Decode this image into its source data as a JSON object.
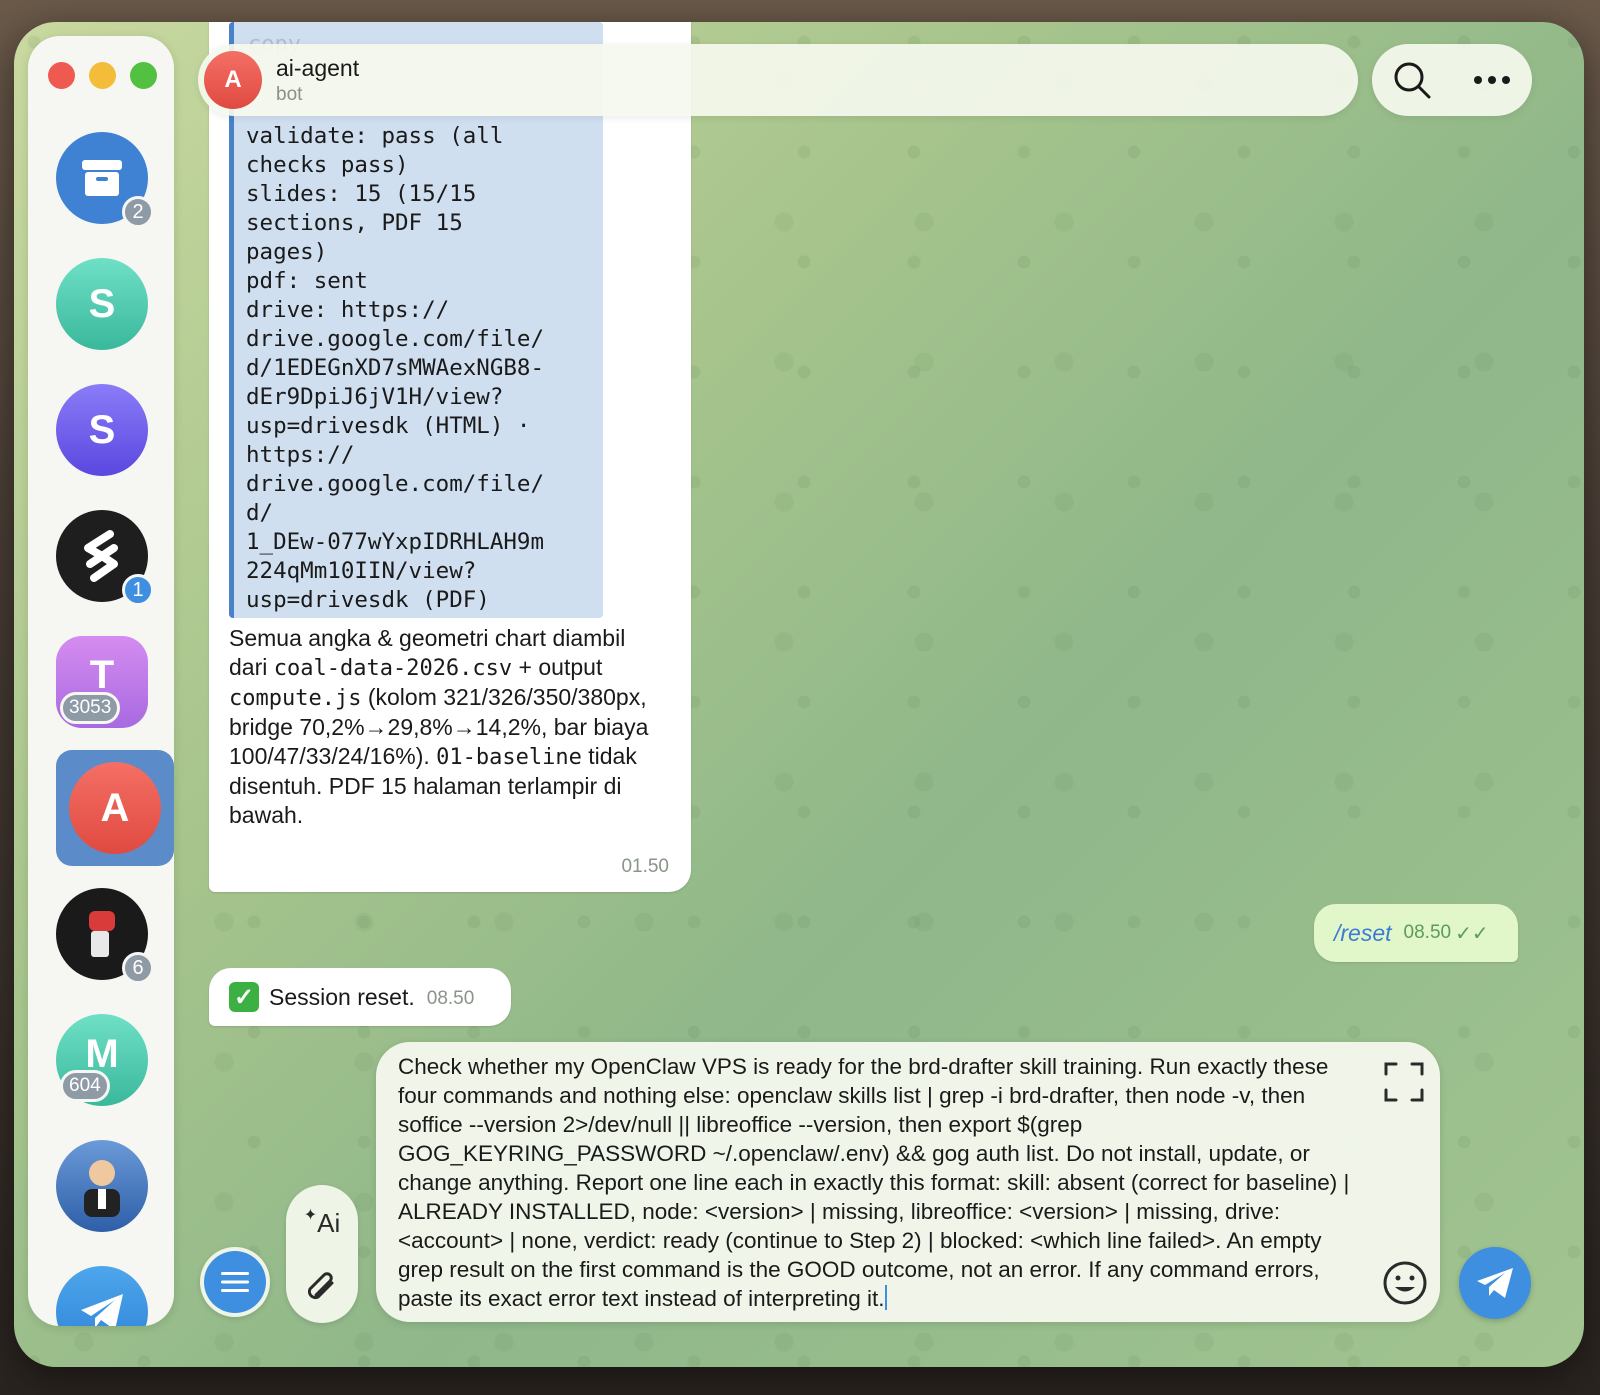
{
  "header": {
    "avatar_letter": "A",
    "title": "ai-agent",
    "subtitle": "bot"
  },
  "sidebar": {
    "items": [
      {
        "letter": "",
        "badge": "2",
        "color": "#3f82d4"
      },
      {
        "letter": "S",
        "badge": "",
        "color": "#4cc9b0"
      },
      {
        "letter": "S",
        "badge": "",
        "color": "#6a5cf0"
      },
      {
        "letter": "",
        "badge": "1",
        "color": "#1e1e1e"
      },
      {
        "letter": "T",
        "badge": "3053",
        "color": "#c27ae8"
      },
      {
        "letter": "A",
        "badge": "",
        "color": "#ee5a50",
        "active": true
      },
      {
        "letter": "",
        "badge": "6",
        "color": "#222222"
      },
      {
        "letter": "M",
        "badge": "604",
        "color": "#54c8a8"
      },
      {
        "letter": "",
        "badge": "",
        "color": "#3c6fb0"
      },
      {
        "letter": "",
        "badge": "",
        "color": "#3f8fe0"
      }
    ]
  },
  "messages": {
    "bot_report": {
      "code_faded": "copy",
      "code_lines": "validate: pass (all\nchecks pass)\nslides: 15 (15/15\nsections, PDF 15\npages)\npdf: sent\ndrive: https://\ndrive.google.com/file/\nd/1EDEGnXD7sMWAexNGB8-\ndEr9DpiJ6jV1H/view?\nusp=drivesdk (HTML) ·\nhttps://\ndrive.google.com/file/\nd/\n1_DEw-077wYxpIDRHLAH9m\n224qMm10IIN/view?\nusp=drivesdk (PDF)",
      "text_a": "Semua angka & geometri chart diambil dari ",
      "mono_a": "coal-data-2026.csv",
      "text_b": " + output ",
      "mono_b": "compute.js",
      "text_c": " (kolom 321/326/350/380px, bridge 70,2%→29,8%→14,2%, bar biaya 100/47/33/24/16%). ",
      "mono_c": "01-baseline",
      "text_d": " tidak disentuh. PDF 15 halaman terlampir di bawah.",
      "time": "01.50"
    },
    "user_reset": {
      "command": "/reset",
      "time": "08.50",
      "ticks": "✓✓"
    },
    "bot_reset": {
      "check": "✓",
      "label": "Session reset.",
      "time": "08.50"
    }
  },
  "composer": {
    "text": "Check whether my OpenClaw VPS is ready for the brd-drafter skill training. Run exactly these four commands and nothing else: openclaw skills list | grep -i brd-drafter, then node -v, then soffice --version 2>/dev/null || libreoffice --version, then export $(grep GOG_KEYRING_PASSWORD ~/.openclaw/.env) && gog auth list. Do not install, update, or change anything. Report one line each in exactly this format: skill: absent (correct for baseline) | ALREADY INSTALLED, node: <version> | missing, libreoffice: <version> | missing, drive: <account> | none, verdict: ready (continue to Step 2) | blocked: <which line failed>. An empty grep result on the first command is the GOOD outcome, not an error. If any command errors, paste its exact error text instead of interpreting it.",
    "ai_label": "Ai"
  }
}
